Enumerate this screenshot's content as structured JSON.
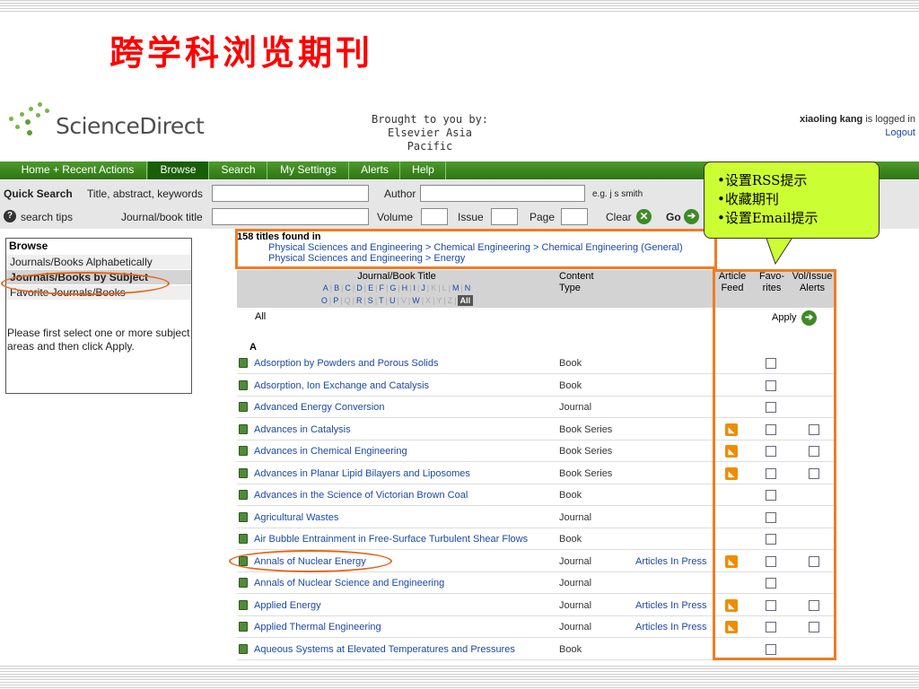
{
  "slide": {
    "title": "跨学科浏览期刊"
  },
  "header": {
    "logo_text": "ScienceDirect",
    "brought_line1": "Brought to you by:",
    "brought_line2": "Elsevier Asia Pacific",
    "user_name": "xiaoling kang",
    "user_suffix": " is logged in",
    "logout": "Logout"
  },
  "nav": {
    "tabs": [
      "Home + Recent Actions",
      "Browse",
      "Search",
      "My Settings",
      "Alerts",
      "Help"
    ],
    "active": "Browse"
  },
  "quick_search": {
    "label": "Quick Search",
    "title_label": "Title, abstract, keywords",
    "author_label": "Author",
    "example": "e.g. j s smith",
    "tips": "search tips",
    "journal_label": "Journal/book title",
    "volume_label": "Volume",
    "issue_label": "Issue",
    "page_label": "Page",
    "clear": "Clear",
    "go": "Go"
  },
  "browse_panel": {
    "heading": "Browse",
    "items": [
      "Journals/Books Alphabetically",
      "Journals/Books by Subject",
      "Favorite Journals/Books"
    ],
    "message": "Please first select one or more subject areas and then click Apply."
  },
  "results": {
    "count_text": "158 titles found in",
    "path1": "Physical Sciences and Engineering > Chemical Engineering > Chemical Engineering (General)",
    "path2": "Physical Sciences and Engineering > Energy",
    "col_title": "Journal/Book Title",
    "col_type_line1": "Content",
    "col_type_line2": "Type",
    "col_feed_line1": "Article",
    "col_feed_line2": "Feed",
    "col_fav_line1": "Favo-",
    "col_fav_line2": "rites",
    "col_alert_line1": "Vol/Issue",
    "col_alert_line2": "Alerts",
    "alpha_row1": [
      "A",
      "B",
      "C",
      "D",
      "E",
      "F",
      "G",
      "H",
      "I",
      "J",
      "K",
      "L",
      "M",
      "N"
    ],
    "alpha_row2": [
      "O",
      "P",
      "Q",
      "R",
      "S",
      "T",
      "U",
      "V",
      "W",
      "X",
      "Y",
      "Z",
      "All"
    ],
    "all_label": "All",
    "apply": "Apply",
    "section_letter": "A",
    "rows": [
      {
        "title": "Adsorption by Powders and Porous Solids",
        "type": "Book",
        "in_press": "",
        "feed": false,
        "alert": false
      },
      {
        "title": "Adsorption, Ion Exchange and Catalysis",
        "type": "Book",
        "in_press": "",
        "feed": false,
        "alert": false
      },
      {
        "title": "Advanced Energy Conversion",
        "type": "Journal",
        "in_press": "",
        "feed": false,
        "alert": false
      },
      {
        "title": "Advances in Catalysis",
        "type": "Book Series",
        "in_press": "",
        "feed": true,
        "alert": true
      },
      {
        "title": "Advances in Chemical Engineering",
        "type": "Book Series",
        "in_press": "",
        "feed": true,
        "alert": true
      },
      {
        "title": "Advances in Planar Lipid Bilayers and Liposomes",
        "type": "Book Series",
        "in_press": "",
        "feed": true,
        "alert": true
      },
      {
        "title": "Advances in the Science of Victorian Brown Coal",
        "type": "Book",
        "in_press": "",
        "feed": false,
        "alert": false
      },
      {
        "title": "Agricultural Wastes",
        "type": "Journal",
        "in_press": "",
        "feed": false,
        "alert": false
      },
      {
        "title": "Air Bubble Entrainment in Free-Surface Turbulent Shear Flows",
        "type": "Book",
        "in_press": "",
        "feed": false,
        "alert": false
      },
      {
        "title": "Annals of Nuclear Energy",
        "type": "Journal",
        "in_press": "Articles In Press",
        "feed": true,
        "alert": true
      },
      {
        "title": "Annals of Nuclear Science and Engineering",
        "type": "Journal",
        "in_press": "",
        "feed": false,
        "alert": false
      },
      {
        "title": "Applied Energy",
        "type": "Journal",
        "in_press": "Articles In Press",
        "feed": true,
        "alert": true
      },
      {
        "title": "Applied Thermal Engineering",
        "type": "Journal",
        "in_press": "Articles In Press",
        "feed": true,
        "alert": true
      },
      {
        "title": "Aqueous Systems at Elevated Temperatures and Pressures",
        "type": "Book",
        "in_press": "",
        "feed": false,
        "alert": false
      }
    ]
  },
  "callout": {
    "lines": [
      "•设置RSS提示",
      "•收藏期刊",
      "•设置Email提示"
    ]
  },
  "colors": {
    "title_red": "#ff0000",
    "nav_green": "#3a8a1e",
    "highlight_orange": "#f07c22",
    "callout_bg": "#ccff33",
    "link_blue": "#1b48a8"
  }
}
